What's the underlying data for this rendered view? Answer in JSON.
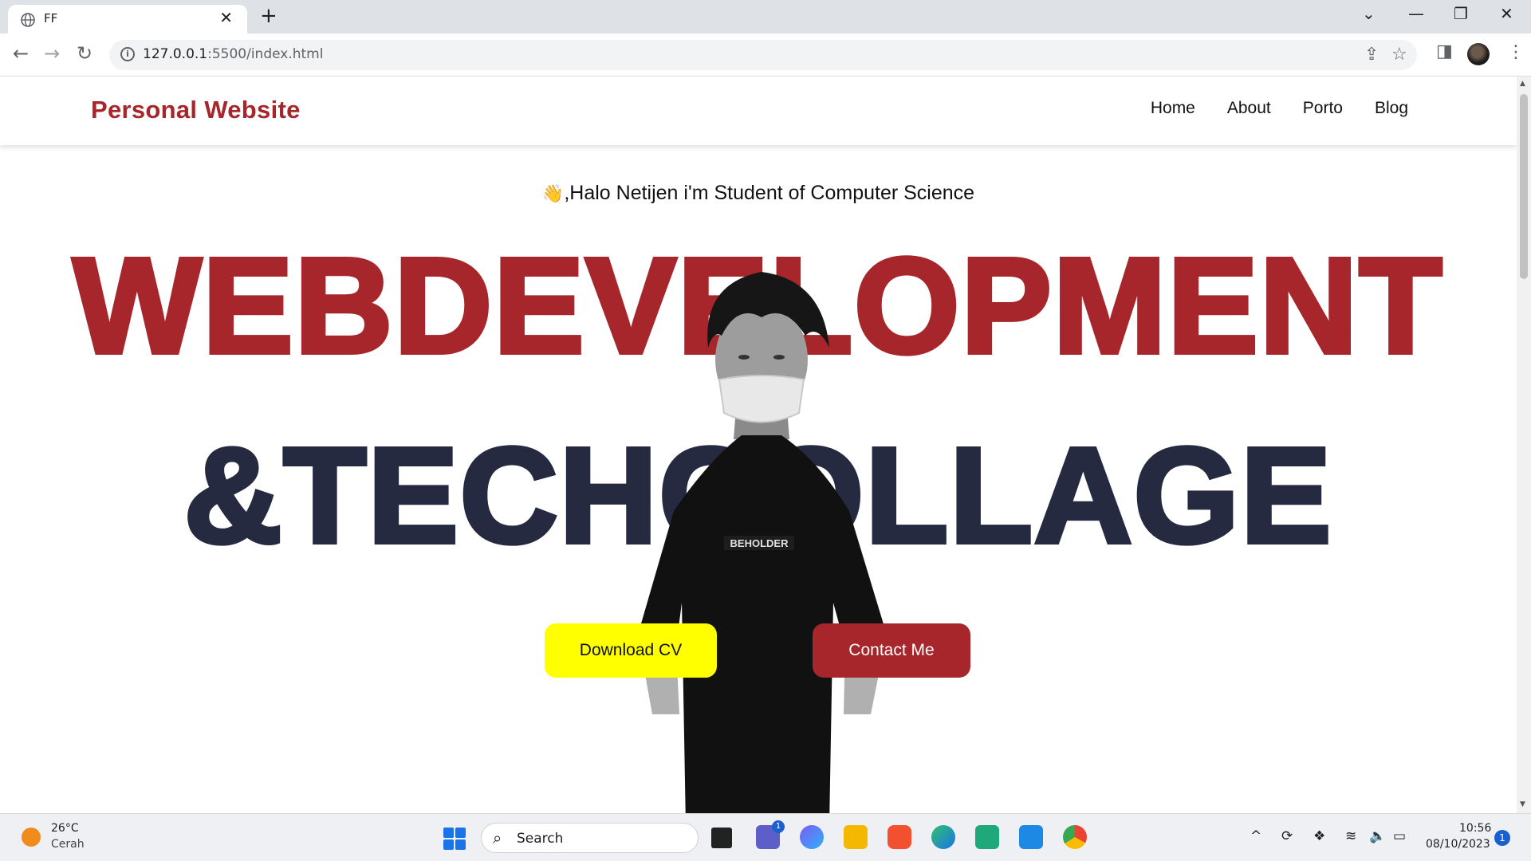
{
  "browser": {
    "tab_title": "FF",
    "tab_close": "✕",
    "new_tab": "+",
    "url_host": "127.0.0.1",
    "url_rest": ":5500/index.html",
    "controls": {
      "tabsearch": "⌄",
      "minimize": "—",
      "restore": "❐",
      "close": "✕"
    }
  },
  "site": {
    "brand": "Personal Website",
    "nav": [
      "Home",
      "About",
      "Porto",
      "Blog"
    ],
    "greeting_emoji": "👋",
    "greeting": ",Halo Netijen i'm Student of Computer Science",
    "headline_1": "WEBDEVELOPMENT",
    "headline_2": "&TECHCOLLAGE",
    "shirt_text": "BEHOLDER",
    "buttons": {
      "download": "Download CV",
      "contact": "Contact Me"
    }
  },
  "taskbar": {
    "weather_temp": "26°C",
    "weather_desc": "Cerah",
    "search_label": "Search",
    "teams_badge": "1",
    "time": "10:56",
    "date": "08/10/2023",
    "notifications": "1"
  },
  "colors": {
    "brand_red": "#a6262b",
    "navy": "#262a40",
    "cv_yellow": "#ffff00"
  },
  "icons": [
    "globe-icon",
    "back-arrow-icon",
    "forward-arrow-icon",
    "reload-icon",
    "info-icon",
    "share-icon",
    "star-icon",
    "sidebar-icon",
    "kebab-menu-icon",
    "windows-start-icon",
    "search-icon",
    "wifi-icon",
    "volume-icon",
    "battery-icon"
  ]
}
